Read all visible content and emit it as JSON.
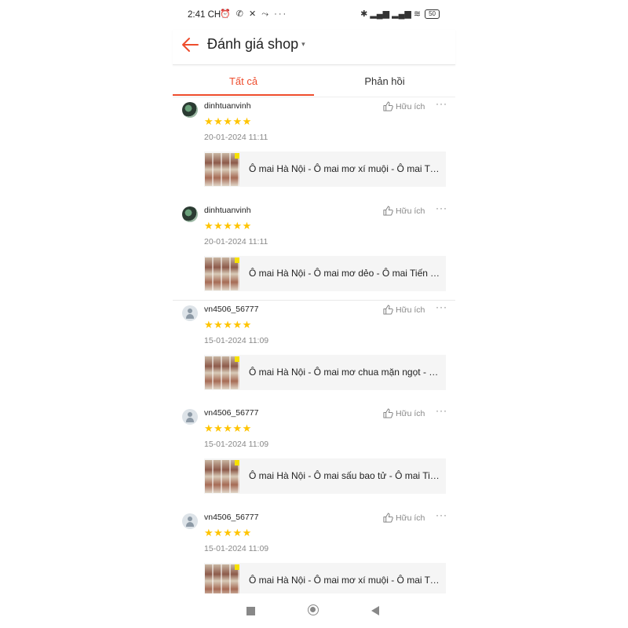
{
  "status_bar": {
    "time": "2:41 CH",
    "left_icons": "⏰ ✆ ✕ ⤳ ···",
    "right_icons": "✱ ▂▄▆ ▂▄▆ ≋",
    "battery": "50"
  },
  "header": {
    "title": "Đánh giá shop",
    "caret": "▾"
  },
  "tabs": [
    {
      "label": "Tất cả"
    },
    {
      "label": "Phản hồi"
    }
  ],
  "colors": {
    "accent": "#ee4d2d",
    "star": "#ffc400"
  },
  "reviews": [
    {
      "username": "dinhtuanvinh",
      "rating": 5,
      "stars": "★★★★★",
      "date": "20-01-2024 11:11",
      "helpful_label": "Hữu ích",
      "more": "···",
      "product": "Ô mai Hà Nội - Ô mai mơ xí muội - Ô mai Tiến Thịnh"
    },
    {
      "username": "dinhtuanvinh",
      "rating": 5,
      "stars": "★★★★★",
      "date": "20-01-2024 11:11",
      "helpful_label": "Hữu ích",
      "more": "···",
      "product": "Ô mai Hà Nội - Ô mai mơ dẻo - Ô mai Tiến Thịnh"
    },
    {
      "username": "vn4506_56777",
      "rating": 5,
      "stars": "★★★★★",
      "date": "15-01-2024 11:09",
      "helpful_label": "Hữu ích",
      "more": "···",
      "product": "Ô mai Hà Nội - Ô mai mơ chua mặn ngọt - Ô mai Tiến Thịnh"
    },
    {
      "username": "vn4506_56777",
      "rating": 5,
      "stars": "★★★★★",
      "date": "15-01-2024 11:09",
      "helpful_label": "Hữu ích",
      "more": "···",
      "product": "Ô mai Hà Nội - Ô mai sấu bao tử - Ô mai Tiến Thịnh"
    },
    {
      "username": "vn4506_56777",
      "rating": 5,
      "stars": "★★★★★",
      "date": "15-01-2024 11:09",
      "helpful_label": "Hữu ích",
      "more": "···",
      "product": "Ô mai Hà Nội - Ô mai mơ xí muội - Ô mai Tiến Thịnh"
    }
  ]
}
